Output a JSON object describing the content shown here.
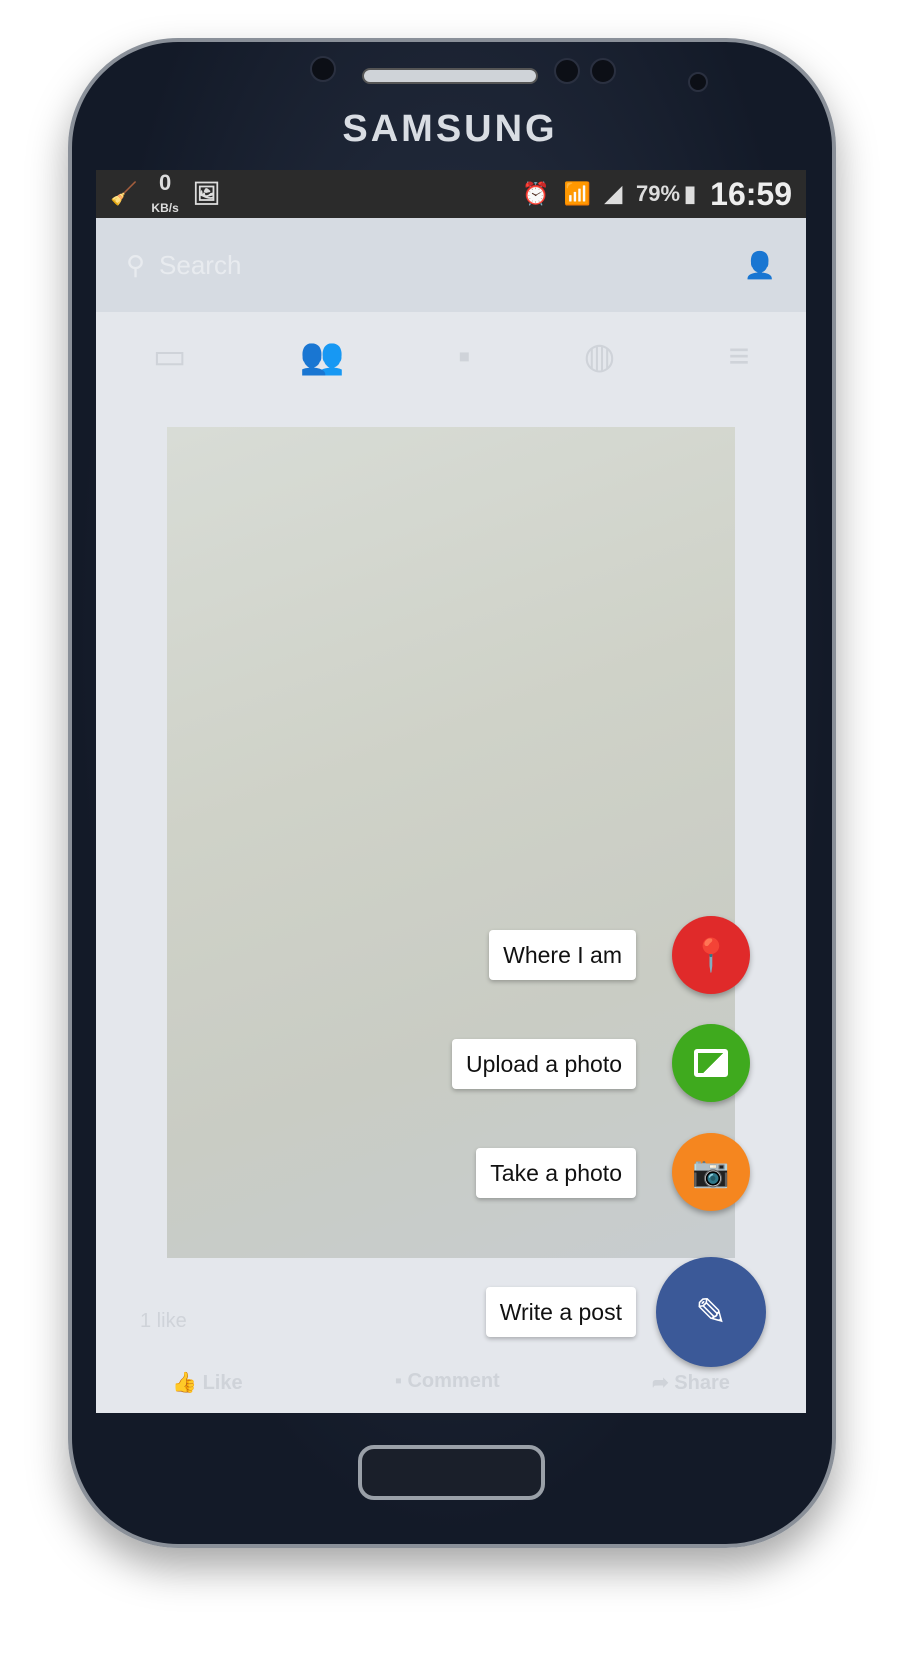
{
  "device": {
    "brand": "SAMSUNG"
  },
  "status_bar": {
    "speed_value": "0",
    "speed_unit": "KB/s",
    "battery": "79%",
    "time": "16:59"
  },
  "search": {
    "placeholder": "Search"
  },
  "tabs": [
    "news-feed",
    "friends",
    "messages",
    "notifications",
    "menu"
  ],
  "post": {
    "likes": "1 like",
    "actions": {
      "like": "Like",
      "comment": "Comment",
      "share": "Share"
    }
  },
  "fab_menu": [
    {
      "label": "Where I am",
      "icon": "location-pin-icon",
      "color": "#e02a2a"
    },
    {
      "label": "Upload a photo",
      "icon": "image-icon",
      "color": "#3faa1e"
    },
    {
      "label": "Take a photo",
      "icon": "camera-icon",
      "color": "#f5861f"
    },
    {
      "label": "Write a post",
      "icon": "pencil-icon",
      "color": "#3b5998"
    }
  ]
}
